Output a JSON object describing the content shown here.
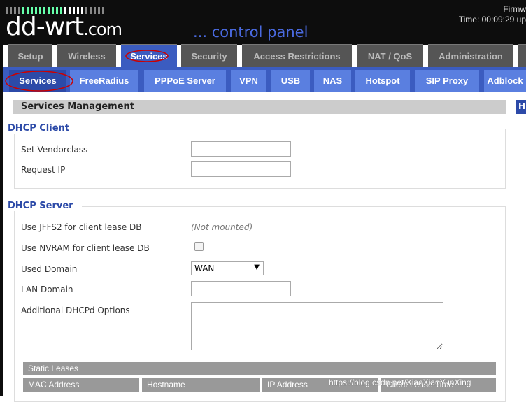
{
  "header": {
    "logo": "dd-wrt",
    "logo_suffix": ".com",
    "tagline": "... control panel",
    "firmware": "Firmw",
    "time": "Time: 00:09:29 up"
  },
  "main_tabs": [
    "Setup",
    "Wireless",
    "Services",
    "Security",
    "Access Restrictions",
    "NAT / QoS",
    "Administration"
  ],
  "sub_tabs": [
    "Services",
    "FreeRadius",
    "PPPoE Server",
    "VPN",
    "USB",
    "NAS",
    "Hotspot",
    "SIP Proxy",
    "Adblock"
  ],
  "section_title": "Services Management",
  "help_button": "H",
  "dhcp_client": {
    "legend": "DHCP Client",
    "vendorclass_label": "Set Vendorclass",
    "vendorclass_value": "",
    "request_ip_label": "Request IP",
    "request_ip_value": ""
  },
  "dhcp_server": {
    "legend": "DHCP Server",
    "jffs2_label": "Use JFFS2 for client lease DB",
    "jffs2_value": "(Not mounted)",
    "nvram_label": "Use NVRAM for client lease DB",
    "nvram_checked": false,
    "used_domain_label": "Used Domain",
    "used_domain_value": "WAN",
    "lan_domain_label": "LAN Domain",
    "lan_domain_value": "",
    "dhcpd_options_label": "Additional DHCPd Options",
    "dhcpd_options_value": ""
  },
  "static_leases": {
    "title": "Static Leases",
    "columns": [
      "MAC Address",
      "Hostname",
      "IP Address",
      "Client Lease Time"
    ]
  },
  "watermark": "https://blog.csdn.net/XiaoXiaoYunXing"
}
